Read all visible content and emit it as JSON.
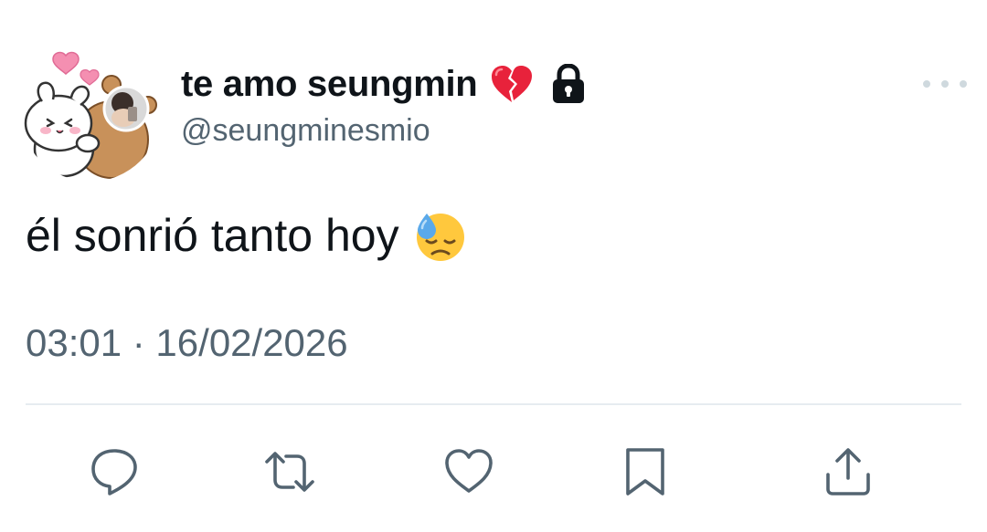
{
  "tweet": {
    "author": {
      "display_name": "te amo seungmin",
      "handle": "@seungminesmio",
      "name_emoji_icon": "broken-heart-icon",
      "protected_icon": "lock-icon",
      "avatar_icon": "avatar"
    },
    "text": "él sonrió tanto hoy",
    "text_emoji_icon": "downcast-face-with-sweat-icon",
    "timestamp": "03:01 · 16/02/2026"
  },
  "actions": [
    {
      "name": "reply",
      "icon": "reply-icon"
    },
    {
      "name": "retweet",
      "icon": "retweet-icon"
    },
    {
      "name": "like",
      "icon": "heart-outline-icon"
    },
    {
      "name": "bookmark",
      "icon": "bookmark-icon"
    },
    {
      "name": "share",
      "icon": "share-icon"
    }
  ],
  "colors": {
    "text_primary": "#0f1419",
    "text_secondary": "#536471",
    "divider": "#e6ecf0",
    "broken_heart": "#e8223b",
    "emoji_face": "#ffc83d",
    "sweat_drop": "#5aa9ea"
  }
}
